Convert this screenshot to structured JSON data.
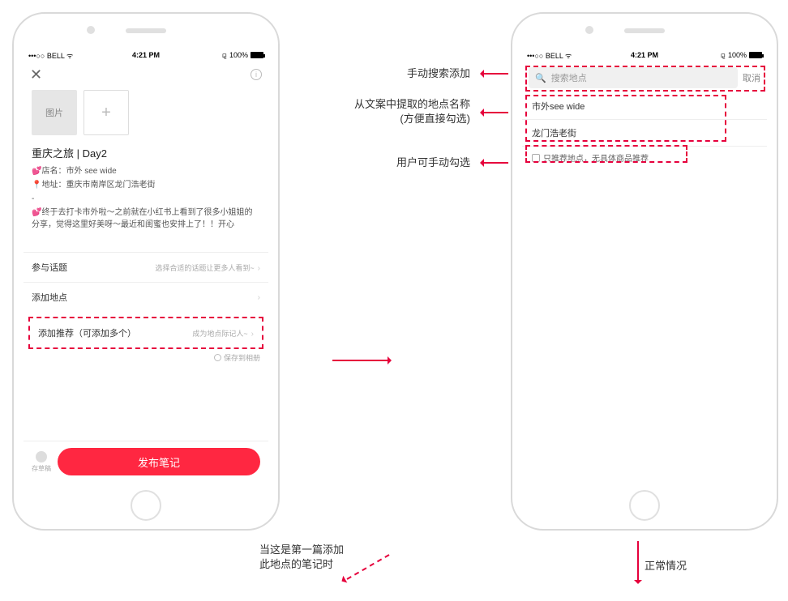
{
  "statusBar": {
    "carrier": "•••○○ BELL",
    "wifiGlyph": "ᯤ",
    "time": "4:21 PM",
    "bluetoothGlyph": "⚼",
    "batteryPct": "100%"
  },
  "leftPhone": {
    "imagePlaceholder": "图片",
    "addGlyph": "+",
    "title": "重庆之旅 | Day2",
    "body": {
      "line1": "💕店名：市外 see wide",
      "line2": "📍地址：重庆市南岸区龙门浩老街",
      "line3": "-",
      "line4": "💕终于去打卡市外啦～之前就在小红书上看到了很多小姐姐的分享，觉得这里好美呀～最近和闺蜜也安排上了！！开心"
    },
    "rows": {
      "topic": {
        "label": "参与话题",
        "hint": "选择合适的话题让更多人看到~"
      },
      "location": {
        "label": "添加地点"
      },
      "recommend": {
        "label": "添加推荐（可添加多个）",
        "hint": "成为地点际记人~"
      }
    },
    "saveToAlbum": "保存到相册",
    "draftLabel": "存草稿",
    "publishLabel": "发布笔记"
  },
  "rightPhone": {
    "searchPlaceholder": "搜索地点",
    "cancel": "取消",
    "suggestions": [
      "市外see wide",
      "龙门浩老街"
    ],
    "recOnly": "只推荐地点，无具体商品推荐"
  },
  "annotations": {
    "a1": "手动搜索添加",
    "a2_line1": "从文案中提取的地点名称",
    "a2_line2": "(方便直接勾选)",
    "a3": "用户可手动勾选",
    "bottomLeft_line1": "当这是第一篇添加",
    "bottomLeft_line2": "此地点的笔记时",
    "bottomRight": "正常情况"
  }
}
